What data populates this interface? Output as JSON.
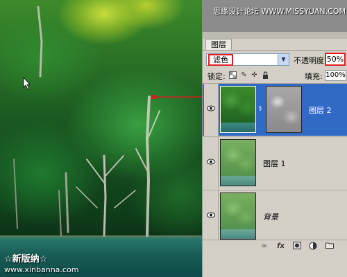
{
  "watermarks": {
    "site": "思缘设计论坛 WWW.MISSYUAN.COM",
    "bottom_line1": "☆新版纳☆",
    "bottom_line2": "www.xinbanna.com"
  },
  "colors": {
    "panel_bg": "#d4d0c8",
    "selected_layer": "#316ac5",
    "highlight_red": "#e02020"
  },
  "layers_panel": {
    "tab_label": "图层",
    "blend_mode": "滤色",
    "opacity_label": "不透明度:",
    "opacity_value": "50%",
    "lock_label": "锁定:",
    "lock_icons": [
      "lock-transparency-icon",
      "lock-image-icon",
      "lock-position-icon",
      "lock-all-icon"
    ],
    "fill_label": "填充:",
    "fill_value": "100%",
    "layers": [
      {
        "name": "图层 2",
        "visible": true,
        "selected": true,
        "has_mask": true
      },
      {
        "name": "图层 1",
        "visible": true,
        "selected": false,
        "has_mask": false
      },
      {
        "name": "背景",
        "visible": true,
        "selected": false,
        "has_mask": false
      }
    ],
    "bottom_icons": [
      "link-icon",
      "fx-icon",
      "mask-icon",
      "adjustment-icon",
      "group-folder-icon"
    ]
  }
}
